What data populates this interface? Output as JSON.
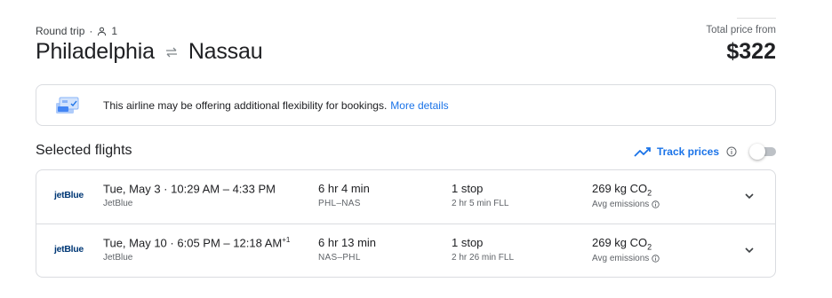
{
  "trip": {
    "type": "Round trip",
    "separator": "·",
    "passengers": "1",
    "origin": "Philadelphia",
    "destination": "Nassau"
  },
  "price": {
    "label": "Total price from",
    "value": "$322"
  },
  "notice": {
    "text": "This airline may be offering additional flexibility for bookings.",
    "link": "More details"
  },
  "section": {
    "title": "Selected flights"
  },
  "track": {
    "label": "Track prices",
    "enabled": false
  },
  "flights": [
    {
      "logo": "jetBlue",
      "date": "Tue, May 3",
      "dot": "·",
      "depart": "10:29 AM",
      "dash": "–",
      "arrive": "4:33 PM",
      "day_offset": "",
      "airline": "JetBlue",
      "duration": "6 hr 4 min",
      "route": "PHL–NAS",
      "stops": "1 stop",
      "layover": "2 hr 5 min FLL",
      "emissions_value": "269 kg CO",
      "emissions_sub": "2",
      "emissions_label": "Avg emissions"
    },
    {
      "logo": "jetBlue",
      "date": "Tue, May 10",
      "dot": "·",
      "depart": "6:05 PM",
      "dash": "–",
      "arrive": "12:18 AM",
      "day_offset": "+1",
      "airline": "JetBlue",
      "duration": "6 hr 13 min",
      "route": "NAS–PHL",
      "stops": "1 stop",
      "layover": "2 hr 26 min FLL",
      "emissions_value": "269 kg CO",
      "emissions_sub": "2",
      "emissions_label": "Avg emissions"
    }
  ],
  "colors": {
    "accent": "#1a73e8",
    "text": "#202124",
    "muted": "#5f6368",
    "border": "#dadce0",
    "jetblue": "#003876"
  },
  "icons": {
    "passenger": "person-icon",
    "swap": "swap-arrows-icon",
    "notice": "booking-flexibility-icon",
    "trend": "trending-icon",
    "info": "info-icon",
    "expand": "chevron-down-icon"
  }
}
